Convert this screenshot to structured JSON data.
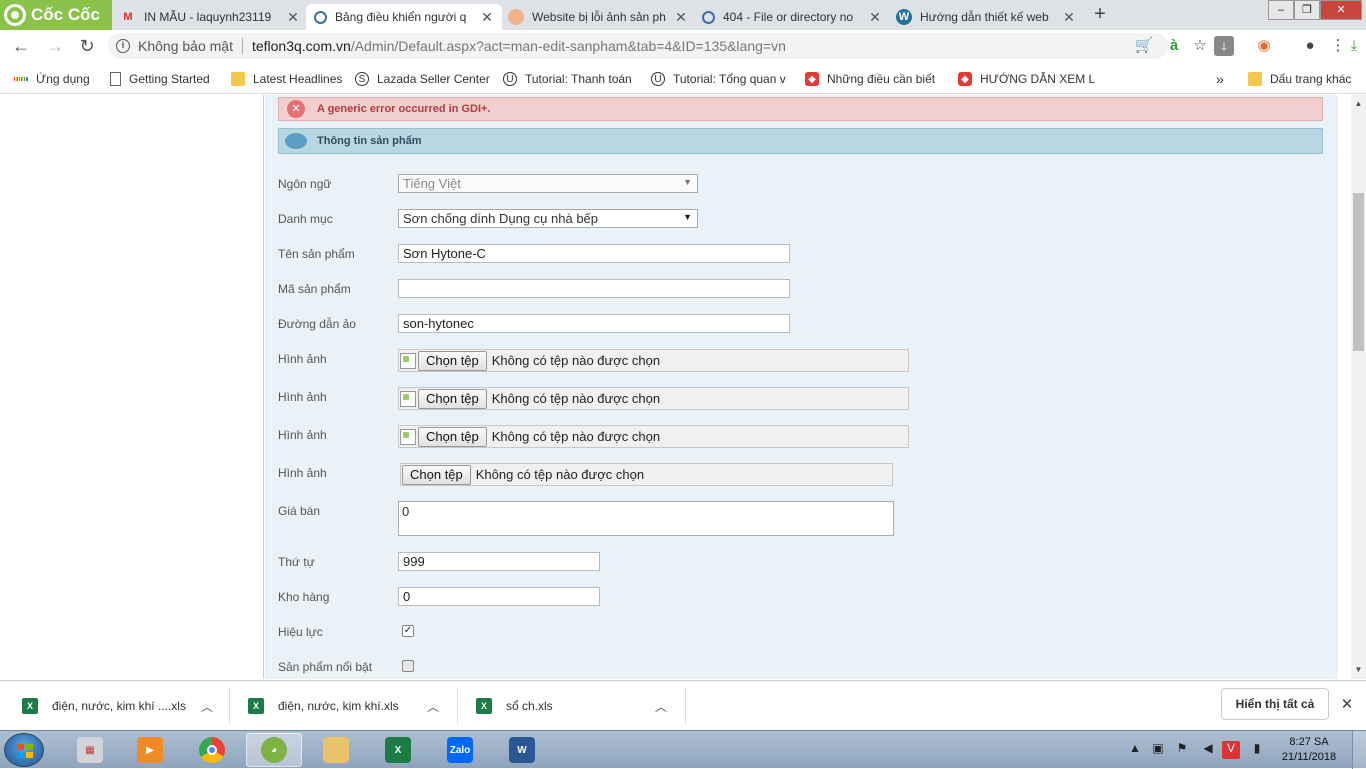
{
  "browser": {
    "brand": "Cốc Cốc",
    "tabs": [
      {
        "label": "IN MẪU - laquynh23119",
        "icon": "gmail-icon"
      },
      {
        "label": "Bảng điều khiển người q",
        "icon": "site-icon",
        "active": true
      },
      {
        "label": "Website bị lỗi ảnh sản ph",
        "icon": "avatar-icon"
      },
      {
        "label": "404 - File or directory no",
        "icon": "site-icon"
      },
      {
        "label": "Hướng dẫn thiết kế web",
        "icon": "wordpress-icon"
      }
    ],
    "new_tab": "+",
    "window_controls": [
      "–",
      "❐",
      "✕"
    ],
    "address": {
      "security": "Không bảo mật",
      "host": "teflon3q.com.vn",
      "path": "/Admin/Default.aspx?act=man-edit-sanpham&tab=4&ID=135&lang=vn"
    },
    "bookmarks": [
      {
        "label": "Ứng dụng",
        "icon": "apps-icon"
      },
      {
        "label": "Getting Started",
        "icon": "page-icon"
      },
      {
        "label": "Latest Headlines",
        "icon": "folder-icon"
      },
      {
        "label": "Lazada Seller Center",
        "icon": "lazada-icon"
      },
      {
        "label": "Tutorial: Thanh toán",
        "icon": "u-icon"
      },
      {
        "label": "Tutorial: Tổng quan v",
        "icon": "u-icon"
      },
      {
        "label": "Những điều cần biết",
        "icon": "red-icon"
      },
      {
        "label": "HƯỚNG DẪN XEM L",
        "icon": "red-icon"
      }
    ],
    "bookmarks_more": "»",
    "other_bookmarks": "Dấu trang khác"
  },
  "page": {
    "error": "A generic error occurred in GDI+.",
    "section_title": "Thông tin sản phẩm",
    "form": {
      "language_label": "Ngôn ngữ",
      "language_value": "Tiếng Việt",
      "category_label": "Danh mục",
      "category_value": "Sơn chống dính Dụng cụ nhà bếp",
      "name_label": "Tên sản phẩm",
      "name_value": "Sơn Hytone-C",
      "code_label": "Mã sản phẩm",
      "code_value": "",
      "slug_label": "Đường dẫn ảo",
      "slug_value": "son-hytonec",
      "image_label": "Hình ảnh",
      "choose_file": "Chọn tệp",
      "no_file": "Không có tệp nào được chọn",
      "price_label": "Giá bán",
      "price_value": "0",
      "order_label": "Thứ tự",
      "order_value": "999",
      "stock_label": "Kho hàng",
      "stock_value": "0",
      "active_label": "Hiệu lực",
      "active_checked": true,
      "featured_label": "Sản phẩm nổi bật",
      "featured_checked": false
    }
  },
  "downloads": {
    "items": [
      {
        "name": "điện, nước, kim khí ....xls"
      },
      {
        "name": "điện, nước, kim khí.xls"
      },
      {
        "name": "sổ ch.xls"
      }
    ],
    "show_all": "Hiển thị tất cả"
  },
  "taskbar": {
    "time": "8:27 SA",
    "date": "21/11/2018",
    "apps": [
      "windows-media-player-icon",
      "media-center-icon",
      "chrome-icon",
      "coccoc-icon",
      "file-explorer-icon",
      "excel-icon",
      "zalo-icon",
      "word-icon"
    ]
  },
  "colors": {
    "brand_green": "#8bc34a",
    "error_bg": "#f2cfcf",
    "section_bg": "#b8d7e2",
    "page_bg": "#eaf2f8"
  }
}
